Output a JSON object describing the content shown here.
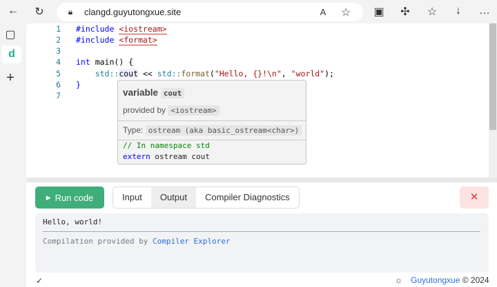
{
  "browser": {
    "url": "clangd.guyutongxue.site"
  },
  "editor": {
    "lines": [
      {
        "n": "1"
      },
      {
        "n": "2"
      },
      {
        "n": "3"
      },
      {
        "n": "4"
      },
      {
        "n": "5"
      },
      {
        "n": "6"
      },
      {
        "n": "7"
      }
    ],
    "l1a": "#include ",
    "l1b": "<iostream>",
    "l2a": "#include ",
    "l2b": "<format>",
    "l4a": "int",
    " l4b": "",
    "l4c": " main() {",
    "l5a": "    std::",
    "l5b": "cout",
    " l5c": "",
    "l5d": " << ",
    "l5e": "std::",
    "l5f": "format",
    "l5g": "(",
    "l5h": "\"Hello, {}!\\n\"",
    "l5i": ", ",
    "l5j": "\"world\"",
    "l5k": ");",
    "l6": "}"
  },
  "hover": {
    "kind": "variable",
    "name": "cout",
    "provided_label": "provided by",
    "provider": "<iostream>",
    "type_label": "Type:",
    "type": "ostream (aka basic_ostream<char>)",
    "comment": "// In namespace std",
    "decl_kw": "extern",
    "decl_rest": " ostream cout"
  },
  "panel": {
    "run_label": "Run code",
    "tabs": [
      "Input",
      "Output",
      "Compiler Diagnostics"
    ],
    "close": "✕",
    "output": "Hello, world!",
    "credit_prefix": "Compilation provided by ",
    "credit_link": "Compiler Explorer"
  },
  "status": {
    "check": "✓",
    "brand": "Guyutongxue",
    "copyright": "© 2024"
  }
}
